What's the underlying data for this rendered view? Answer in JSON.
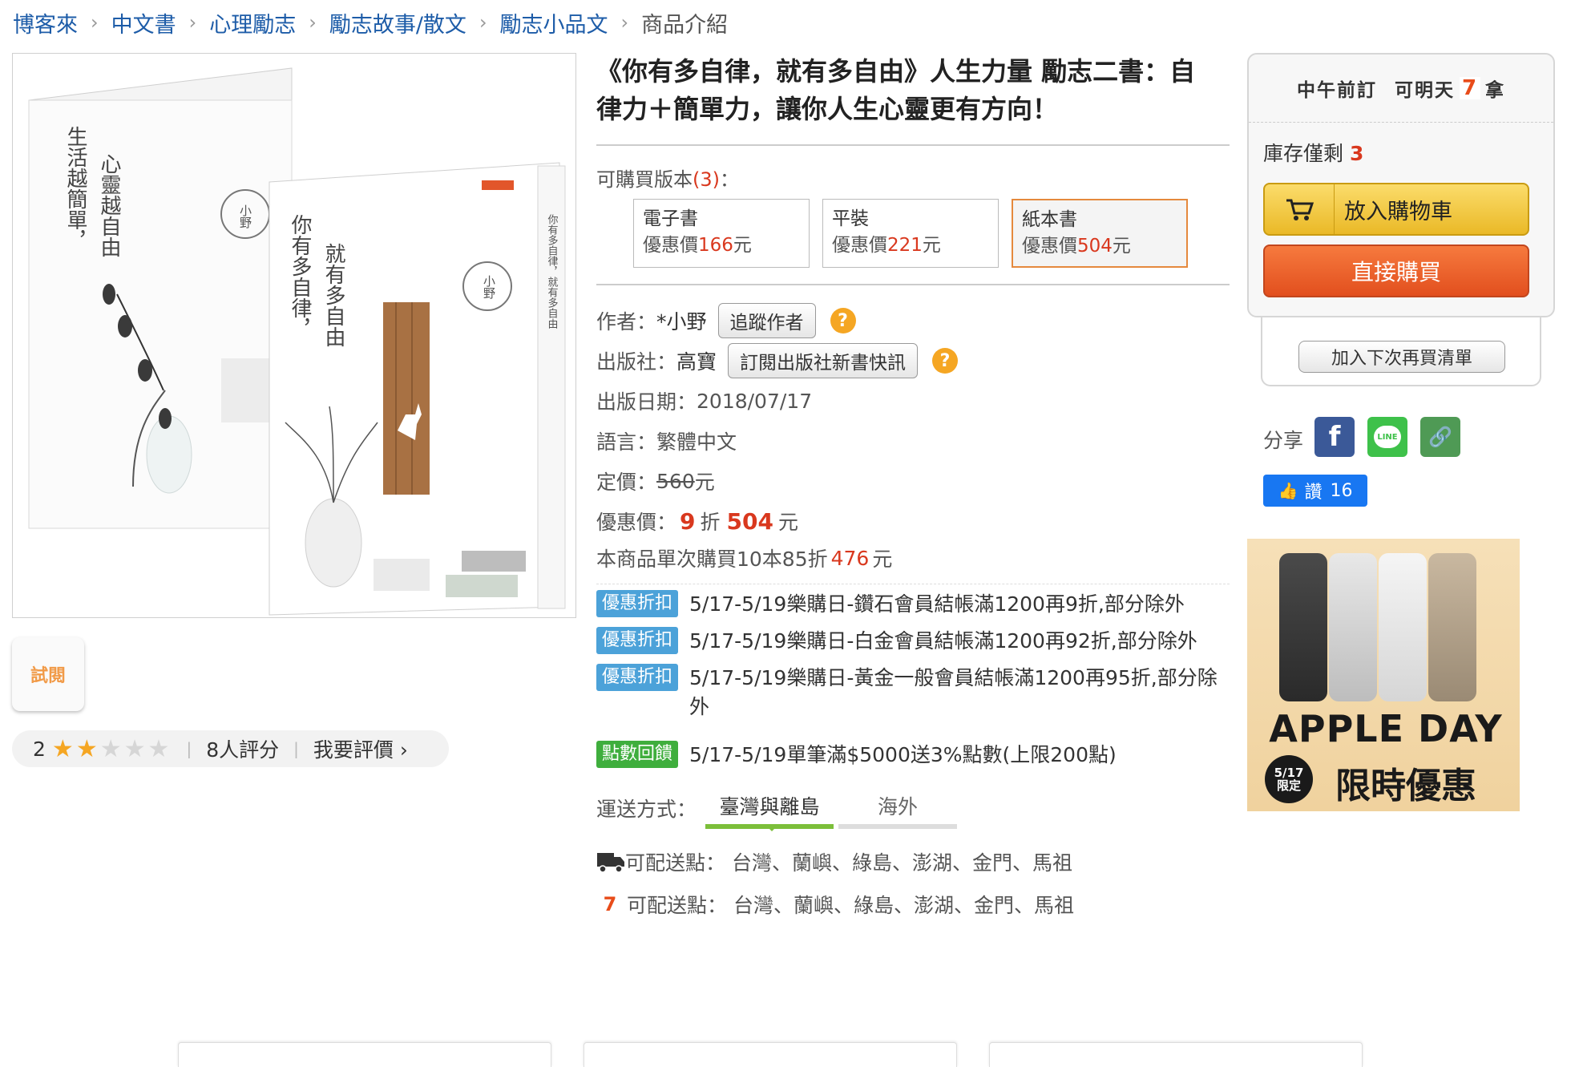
{
  "breadcrumb": {
    "items": [
      "博客來",
      "中文書",
      "心理勵志",
      "勵志故事/散文",
      "勵志小品文"
    ],
    "current": "商品介紹"
  },
  "book_image": {
    "back_cover_title_1": "生活越簡單，",
    "back_cover_title_2": "心靈越自由",
    "front_cover_title_1": "你有多自律，",
    "front_cover_title_2": "就有多自由",
    "author_seal": "小野",
    "spine_text": "你有多自律，就有多自由"
  },
  "trial_button": "試閱",
  "rating": {
    "score": "2",
    "stars_filled": 2,
    "stars_total": 5,
    "count_label": "8人評分",
    "write_review": "我要評價",
    "write_review_arrow": "›"
  },
  "product": {
    "title": "《你有多自律，就有多自由》人生力量 勵志二書：自律力＋簡單力，讓你人生心靈更有方向！",
    "editions_label": "可購買版本",
    "editions_count": "(3)",
    "editions_suffix": "：",
    "editions": [
      {
        "name": "電子書",
        "price_label": "優惠價",
        "price": "166",
        "unit": "元"
      },
      {
        "name": "平裝",
        "price_label": "優惠價",
        "price": "221",
        "unit": "元"
      },
      {
        "name": "紙本書",
        "price_label": "優惠價",
        "price": "504",
        "unit": "元"
      }
    ],
    "author_label": "作者：",
    "author": "*小野",
    "follow_author": "追蹤作者",
    "publisher_label": "出版社：",
    "publisher": "高寶",
    "subscribe_publisher": "訂閱出版社新書快訊",
    "help_mark": "?",
    "publish_date_label": "出版日期：",
    "publish_date": "2018/07/17",
    "language_label": "語言：",
    "language": "繁體中文",
    "list_price_label": "定價：",
    "list_price": "560",
    "list_price_unit": "元",
    "sale_price_label": "優惠價：",
    "discount": "9",
    "discount_unit": "折",
    "sale_price": "504",
    "sale_price_unit": "元",
    "bulk_text": "本商品單次購買10本85折",
    "bulk_price": "476",
    "bulk_unit": "元"
  },
  "promotions": [
    {
      "badge": "優惠折扣",
      "text": "5/17-5/19樂購日-鑽石會員結帳滿1200再9折,部分除外"
    },
    {
      "badge": "優惠折扣",
      "text": "5/17-5/19樂購日-白金會員結帳滿1200再92折,部分除外"
    },
    {
      "badge": "優惠折扣",
      "text": "5/17-5/19樂購日-黃金一般會員結帳滿1200再95折,部分除外"
    },
    {
      "badge": "點數回饋",
      "text": "5/17-5/19單筆滿$5000送3%點數(上限200點)"
    }
  ],
  "shipping": {
    "label": "運送方式：",
    "tabs": [
      "臺灣與離島",
      "海外"
    ],
    "delivery_1": "可配送點： 台灣、蘭嶼、綠島、澎湖、金門、馬祖",
    "delivery_2": "可配送點： 台灣、蘭嶼、綠島、澎湖、金門、馬祖"
  },
  "order_panel": {
    "head_1": "中午前訂",
    "head_2": "可明天",
    "head_3": "拿",
    "seven_glyph": "7",
    "stock_label": "庫存僅剩",
    "stock_count": "3",
    "add_to_cart": "放入購物車",
    "buy_now": "直接購買",
    "wishlist": "加入下次再買清單"
  },
  "share": {
    "label": "分享",
    "facebook_glyph": "f",
    "line_glyph": "LINE",
    "link_glyph": "🔗",
    "like_label": "讚",
    "like_count": "16"
  },
  "ad": {
    "title": "APPLE DAY",
    "date_1": "5/17",
    "date_2": "限定",
    "subtitle": "限時優惠"
  },
  "colors": {
    "link_blue": "#1d5ca8",
    "price_red": "#d9381e",
    "cart_yellow": "#eab927",
    "buy_orange": "#e24f1e",
    "promo_blue": "#4ca2d9",
    "promo_green": "#3fae3d"
  }
}
